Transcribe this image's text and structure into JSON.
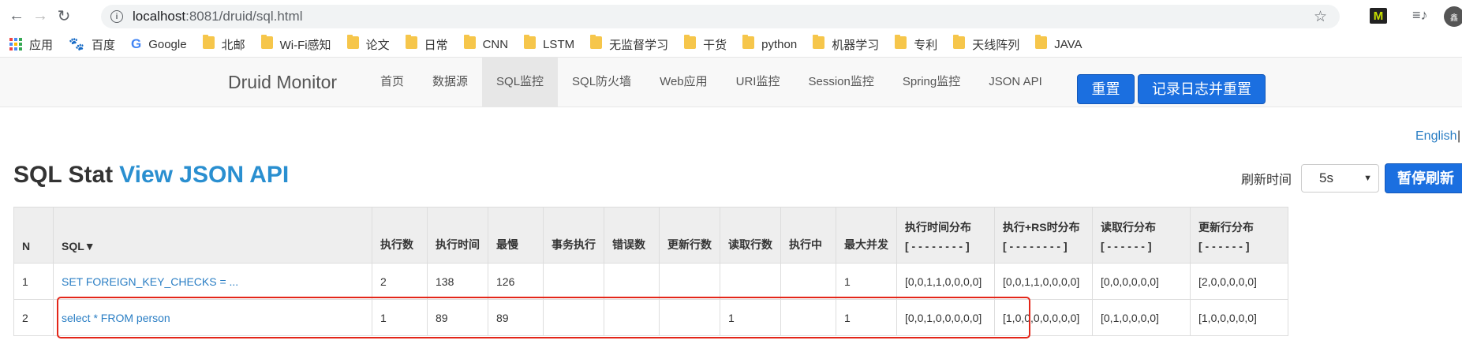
{
  "browser": {
    "url_host": "localhost",
    "url_path": ":8081/druid/sql.html",
    "bookmarks": [
      {
        "label": "应用",
        "icon": "apps-grid-icon"
      },
      {
        "label": "百度",
        "icon": "baidu-paw-icon"
      },
      {
        "label": "Google",
        "icon": "google-icon"
      },
      {
        "label": "北邮",
        "icon": "folder-icon"
      },
      {
        "label": "Wi-Fi感知",
        "icon": "folder-icon"
      },
      {
        "label": "论文",
        "icon": "folder-icon"
      },
      {
        "label": "日常",
        "icon": "folder-icon"
      },
      {
        "label": "CNN",
        "icon": "folder-icon"
      },
      {
        "label": "LSTM",
        "icon": "folder-icon"
      },
      {
        "label": "无监督学习",
        "icon": "folder-icon"
      },
      {
        "label": "干货",
        "icon": "folder-icon"
      },
      {
        "label": "python",
        "icon": "folder-icon"
      },
      {
        "label": "机器学习",
        "icon": "folder-icon"
      },
      {
        "label": "专利",
        "icon": "folder-icon"
      },
      {
        "label": "天线阵列",
        "icon": "folder-icon"
      },
      {
        "label": "JAVA",
        "icon": "folder-icon"
      }
    ],
    "extension_m": "M",
    "profile_label": "鑫"
  },
  "nav": {
    "brand": "Druid Monitor",
    "items": [
      {
        "label": "首页"
      },
      {
        "label": "数据源"
      },
      {
        "label": "SQL监控"
      },
      {
        "label": "SQL防火墙"
      },
      {
        "label": "Web应用"
      },
      {
        "label": "URI监控"
      },
      {
        "label": "Session监控"
      },
      {
        "label": "Spring监控"
      },
      {
        "label": "JSON API"
      }
    ],
    "reset_button": "重置",
    "log_reset_button": "记录日志并重置"
  },
  "lang": {
    "english": "English",
    "separator": "|"
  },
  "page": {
    "title": "SQL Stat",
    "title_link": "View JSON API",
    "refresh_label": "刷新时间",
    "refresh_value": "5s",
    "pause_button": "暂停刷新"
  },
  "table": {
    "headers": [
      {
        "label": "N",
        "sub": ""
      },
      {
        "label": "SQL▼",
        "sub": ""
      },
      {
        "label": "执行数",
        "sub": ""
      },
      {
        "label": "执行时间",
        "sub": ""
      },
      {
        "label": "最慢",
        "sub": ""
      },
      {
        "label": "事务执行",
        "sub": ""
      },
      {
        "label": "错误数",
        "sub": ""
      },
      {
        "label": "更新行数",
        "sub": ""
      },
      {
        "label": "读取行数",
        "sub": ""
      },
      {
        "label": "执行中",
        "sub": ""
      },
      {
        "label": "最大并发",
        "sub": ""
      },
      {
        "label": "执行时间分布",
        "sub": "[ - - - - - - - - ]"
      },
      {
        "label": "执行+RS时分布",
        "sub": "[ - - - - - - - - ]"
      },
      {
        "label": "读取行分布",
        "sub": "[ - - - - - - ]"
      },
      {
        "label": "更新行分布",
        "sub": "[ - - - - - - ]"
      }
    ],
    "rows": [
      [
        "1",
        "SET FOREIGN_KEY_CHECKS = ...",
        "2",
        "138",
        "126",
        "",
        "",
        "",
        "",
        "",
        "1",
        "[0,0,1,1,0,0,0,0]",
        "[0,0,1,1,0,0,0,0]",
        "[0,0,0,0,0,0]",
        "[2,0,0,0,0,0]"
      ],
      [
        "2",
        "select * FROM person",
        "1",
        "89",
        "89",
        "",
        "",
        "",
        "1",
        "",
        "1",
        "[0,0,1,0,0,0,0,0]",
        "[1,0,0,0,0,0,0,0]",
        "[0,1,0,0,0,0]",
        "[1,0,0,0,0,0]"
      ]
    ]
  }
}
